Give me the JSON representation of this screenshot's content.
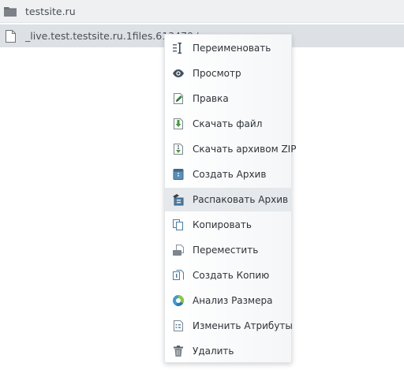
{
  "file_list": {
    "rows": [
      {
        "icon": "folder-icon",
        "name": "testsite.ru"
      },
      {
        "icon": "file-icon",
        "name": "_live.test.testsite.ru.1files.613479.tar"
      }
    ]
  },
  "context_menu": {
    "active_index": 6,
    "items": [
      {
        "icon": "rename-icon",
        "label": "Переименовать"
      },
      {
        "icon": "eye-icon",
        "label": "Просмотр"
      },
      {
        "icon": "edit-icon",
        "label": "Правка"
      },
      {
        "icon": "download-icon",
        "label": "Скачать файл"
      },
      {
        "icon": "zip-download-icon",
        "label": "Скачать архивом ZIP"
      },
      {
        "icon": "archive-icon",
        "label": "Создать Архив"
      },
      {
        "icon": "extract-icon",
        "label": "Распаковать Архив"
      },
      {
        "icon": "copy-icon",
        "label": "Копировать"
      },
      {
        "icon": "move-icon",
        "label": "Переместить"
      },
      {
        "icon": "duplicate-icon",
        "label": "Создать Копию"
      },
      {
        "icon": "size-analysis-icon",
        "label": "Анализ Размера"
      },
      {
        "icon": "attributes-icon",
        "label": "Изменить Атрибуты"
      },
      {
        "icon": "trash-icon",
        "label": "Удалить"
      }
    ]
  }
}
